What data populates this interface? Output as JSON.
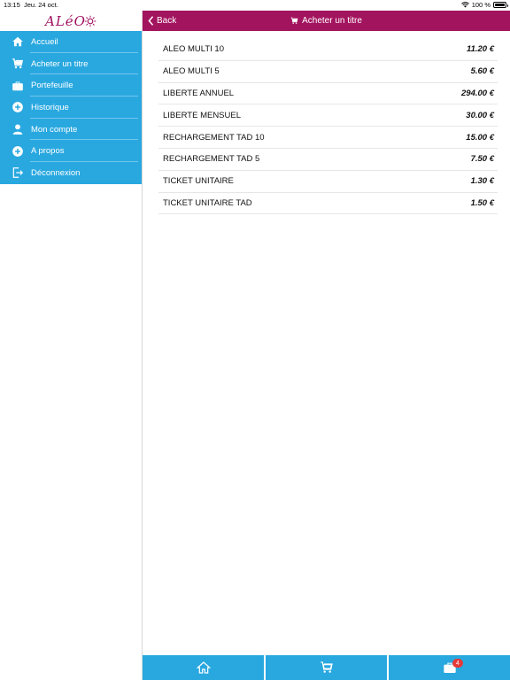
{
  "status_bar": {
    "time": "13:15",
    "date": "Jeu. 24 oct.",
    "battery": "100 %",
    "wifi_icon": "wifi-icon",
    "battery_icon": "battery-icon"
  },
  "brand": {
    "logo_text": "ALéO",
    "logo_color": "#a01060"
  },
  "colors": {
    "accent": "#29a8e0",
    "header": "#a3145f",
    "badge": "#e63939"
  },
  "sidebar": {
    "items": [
      {
        "label": "Accueil",
        "icon": "home-icon"
      },
      {
        "label": "Acheter un titre",
        "icon": "cart-icon"
      },
      {
        "label": "Portefeuille",
        "icon": "wallet-icon"
      },
      {
        "label": "Historique",
        "icon": "plus-circle-icon"
      },
      {
        "label": "Mon compte",
        "icon": "user-icon"
      },
      {
        "label": "A propos",
        "icon": "plus-circle-icon"
      },
      {
        "label": "Déconnexion",
        "icon": "logout-icon"
      }
    ]
  },
  "header": {
    "back_label": "Back",
    "title": "Acheter un titre"
  },
  "products": [
    {
      "name": "ALEO MULTI 10",
      "price": "11.20 €"
    },
    {
      "name": "ALEO MULTI 5",
      "price": "5.60 €"
    },
    {
      "name": "LIBERTE ANNUEL",
      "price": "294.00 €"
    },
    {
      "name": "LIBERTE MENSUEL",
      "price": "30.00 €"
    },
    {
      "name": "RECHARGEMENT TAD 10",
      "price": "15.00 €"
    },
    {
      "name": "RECHARGEMENT TAD 5",
      "price": "7.50 €"
    },
    {
      "name": "TICKET UNITAIRE",
      "price": "1.30 €"
    },
    {
      "name": "TICKET UNITAIRE TAD",
      "price": "1.50 €"
    }
  ],
  "tabbar": {
    "tabs": [
      {
        "icon": "home-icon"
      },
      {
        "icon": "cart-icon"
      },
      {
        "icon": "wallet-icon",
        "badge": "4"
      }
    ]
  }
}
